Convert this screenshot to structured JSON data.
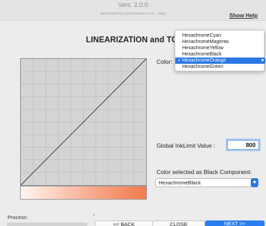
{
  "header": {
    "version": "Vers. 2.0.0",
    "developed_by": "developed by Colorstream s.a.s. - Italy",
    "show_help": "Show Help"
  },
  "title": "LINEARIZATION and TOTAL I",
  "color": {
    "label": "Color:",
    "options": [
      "HexachromeCyan",
      "HexachromeMagenta",
      "HexachromeYellow",
      "HexachromeBlack",
      "HexachromeOrange",
      "HexachromeGreen"
    ],
    "selected": "HexachromeOrange",
    "check": "✓"
  },
  "ink_limit": {
    "label": "Global InkLimit Value :",
    "value": "800"
  },
  "black_component": {
    "label": "Color selected as Black Component:",
    "value": "HexachromeBlack"
  },
  "process": {
    "label": "Process:",
    "caret": "^"
  },
  "buttons": {
    "back": "<< BACK",
    "close": "CLOSE",
    "next": "NEXT >>"
  },
  "colors": {
    "accent": "#2a78e4",
    "gradient_end": "#f37b4e"
  }
}
